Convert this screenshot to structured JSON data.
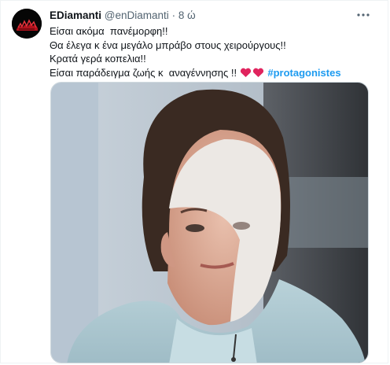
{
  "tweet": {
    "display_name": "EDiamanti",
    "handle": "@enDiamanti",
    "separator": "·",
    "time": "8 ώ",
    "lines": [
      "Είσαι ακόμα  πανέμορφη!!",
      "Θα έλεγα κ ένα μεγάλο μπράβο στους χειρούργους!!",
      "Κρατά γερά κοπελια!!",
      "Είσαι παράδειγμα ζωής κ  αναγέννησης !!"
    ],
    "emoji": "heart-red-emoji x2",
    "hashtag": "#protagonistes",
    "more_icon": "more-horizontal-icon",
    "media_alt": "photo-woman-face-recovering"
  },
  "colors": {
    "hashtag": "#1d9bf0",
    "secondary_text": "#536471",
    "heart": "#e0245e"
  }
}
